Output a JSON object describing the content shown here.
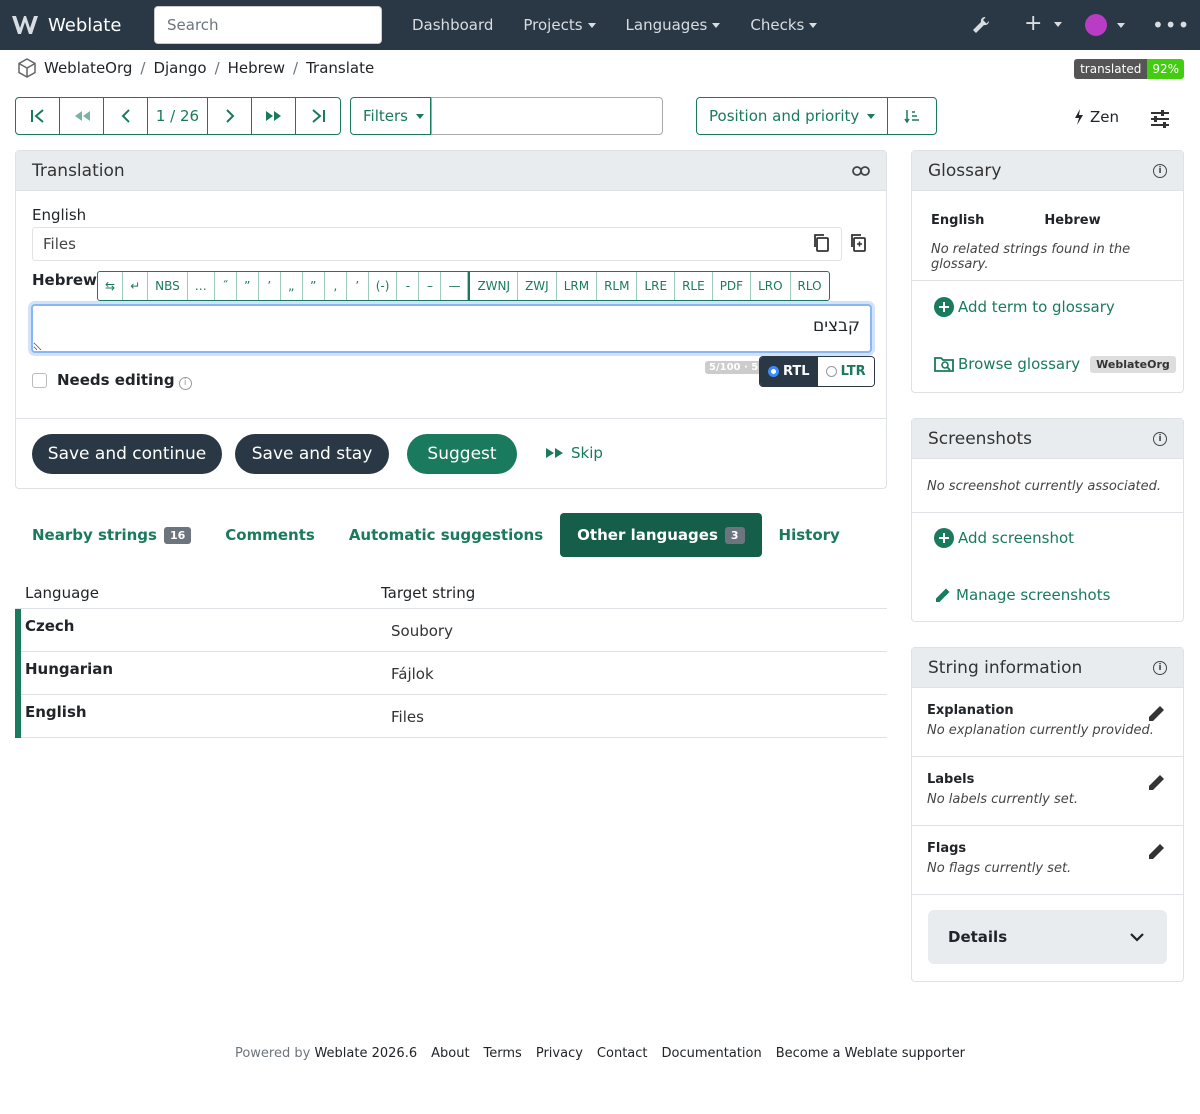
{
  "nav": {
    "brand": "Weblate",
    "search_placeholder": "Search",
    "menu": [
      "Dashboard",
      "Projects",
      "Languages",
      "Checks"
    ]
  },
  "breadcrumb": [
    "WeblateOrg",
    "Django",
    "Hebrew",
    "Translate"
  ],
  "progress_badge": {
    "label": "translated",
    "value": "92%"
  },
  "toolbar": {
    "counter": "1 / 26",
    "filters_label": "Filters",
    "sort_label": "Position and priority",
    "zen_label": "Zen"
  },
  "translation": {
    "title": "Translation",
    "source_label": "English",
    "source_text": "Files",
    "target_label": "Hebrew",
    "special_chars": [
      "⇆",
      "↵",
      "NBS",
      "…",
      "˝",
      "”",
      "’",
      "„",
      "”",
      "‚",
      "’",
      "(-)",
      "-",
      "–",
      "—"
    ],
    "direction_chars": [
      "ZWNJ",
      "ZWJ",
      "LRM",
      "RLM",
      "LRE",
      "RLE",
      "PDF",
      "LRO",
      "RLO"
    ],
    "target_value": "קבצים",
    "needs_editing": "Needs editing",
    "char_count": "5/100 · 5",
    "dir_rtl": "RTL",
    "dir_ltr": "LTR",
    "save_continue": "Save and continue",
    "save_stay": "Save and stay",
    "suggest": "Suggest",
    "skip": "Skip"
  },
  "tabs": [
    {
      "label": "Nearby strings",
      "count": "16"
    },
    {
      "label": "Comments",
      "count": ""
    },
    {
      "label": "Automatic suggestions",
      "count": ""
    },
    {
      "label": "Other languages",
      "count": "3"
    },
    {
      "label": "History",
      "count": ""
    }
  ],
  "other_languages": {
    "headers": [
      "Language",
      "Target string"
    ],
    "rows": [
      {
        "language": "Czech",
        "target": "Soubory"
      },
      {
        "language": "Hungarian",
        "target": "Fájlok"
      },
      {
        "language": "English",
        "target": "Files"
      }
    ]
  },
  "glossary": {
    "title": "Glossary",
    "col_source": "English",
    "col_target": "Hebrew",
    "empty": "No related strings found in the glossary.",
    "add_term": "Add term to glossary",
    "browse": "Browse glossary",
    "browse_badge": "WeblateOrg"
  },
  "screenshots": {
    "title": "Screenshots",
    "empty": "No screenshot currently associated.",
    "add": "Add screenshot",
    "manage": "Manage screenshots"
  },
  "string_info": {
    "title": "String information",
    "explanation_title": "Explanation",
    "explanation_text": "No explanation currently provided.",
    "labels_title": "Labels",
    "labels_text": "No labels currently set.",
    "flags_title": "Flags",
    "flags_text": "No flags currently set.",
    "details": "Details"
  },
  "footer": {
    "powered_prefix": "Powered by",
    "powered_link": "Weblate 2026.6",
    "links": [
      "About",
      "Terms",
      "Privacy",
      "Contact",
      "Documentation",
      "Become a Weblate supporter"
    ]
  },
  "colors": {
    "navbar": "#2a3744",
    "accent": "#1a7a5e",
    "progress": "#44cc11"
  }
}
